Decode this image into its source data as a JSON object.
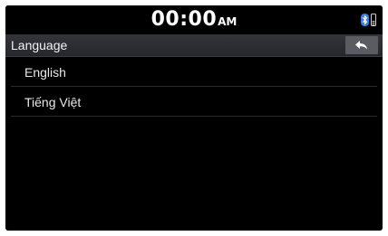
{
  "status_bar": {
    "time": "00:00",
    "ampm": "AM",
    "icons": [
      "bluetooth-icon",
      "phone-signal-icon"
    ]
  },
  "header": {
    "title": "Language",
    "back_icon": "back-arrow-icon"
  },
  "languages": [
    {
      "label": "English"
    },
    {
      "label": "Tiếng Việt"
    }
  ],
  "colors": {
    "background": "#000000",
    "header_bar": "#2c2d32",
    "back_button": "#5b5c61",
    "bluetooth": "#3b7fd6",
    "text": "#ffffff"
  }
}
